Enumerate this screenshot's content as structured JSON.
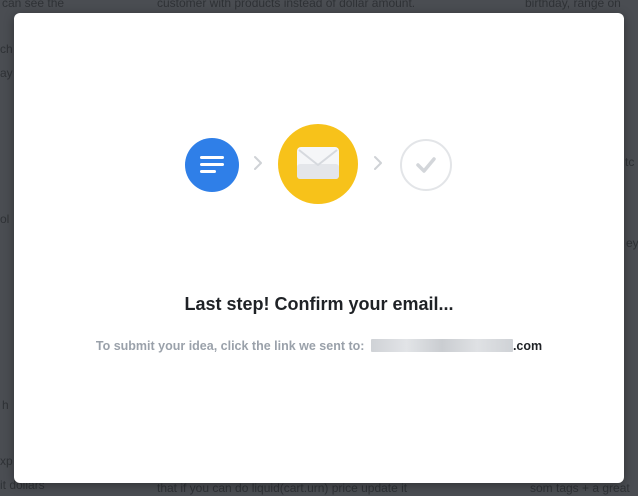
{
  "modal": {
    "title": "Last step! Confirm your email...",
    "instruction": "To submit your idea, click the link we sent to:",
    "email_suffix": ".com"
  },
  "stepper": {
    "steps": [
      {
        "name": "details",
        "icon": "lines-icon",
        "state": "complete",
        "color": "#2f7fe8"
      },
      {
        "name": "confirm-email",
        "icon": "envelope-icon",
        "state": "current",
        "color": "#f7c21a"
      },
      {
        "name": "done",
        "icon": "checkmark-icon",
        "state": "pending",
        "color": "#e3e5e8"
      }
    ]
  },
  "background_text": [
    "can see the",
    "customer with products instead of dollar amount.",
    "birthday, range on",
    "ch",
    "ay",
    "tc",
    "ol",
    "ey",
    "h",
    "xp",
    "it dollars",
    "that if you can do liquid(cart.urn) price update it",
    "som tags + a great"
  ]
}
